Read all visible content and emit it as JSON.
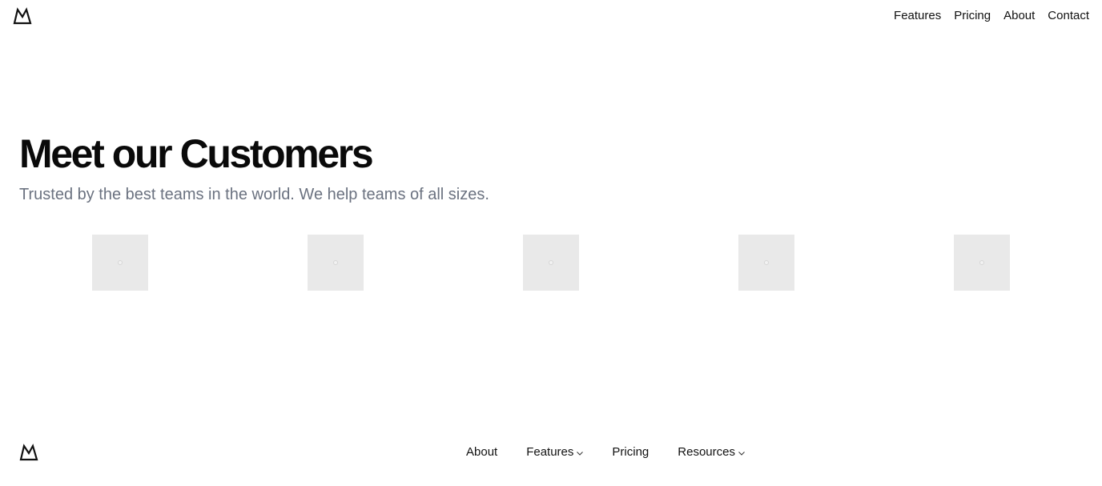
{
  "header": {
    "logo_icon": "mountain-logo-icon",
    "nav": [
      {
        "label": "Features"
      },
      {
        "label": "Pricing"
      },
      {
        "label": "About"
      },
      {
        "label": "Contact"
      }
    ]
  },
  "hero": {
    "title": "Meet our Customers",
    "subtitle": "Trusted by the best teams in the world. We help teams of all sizes."
  },
  "customers": {
    "logos": [
      {
        "icon": "image-placeholder-icon"
      },
      {
        "icon": "image-placeholder-icon"
      },
      {
        "icon": "image-placeholder-icon"
      },
      {
        "icon": "image-placeholder-icon"
      },
      {
        "icon": "image-placeholder-icon"
      }
    ],
    "placeholder_color": "#e9e9e9"
  },
  "footer": {
    "logo_icon": "mountain-logo-icon",
    "nav": [
      {
        "label": "About",
        "has_dropdown": false
      },
      {
        "label": "Features",
        "has_dropdown": true
      },
      {
        "label": "Pricing",
        "has_dropdown": false
      },
      {
        "label": "Resources",
        "has_dropdown": true
      }
    ]
  },
  "colors": {
    "text": "#111111",
    "muted": "#6b7280",
    "background": "#ffffff"
  }
}
